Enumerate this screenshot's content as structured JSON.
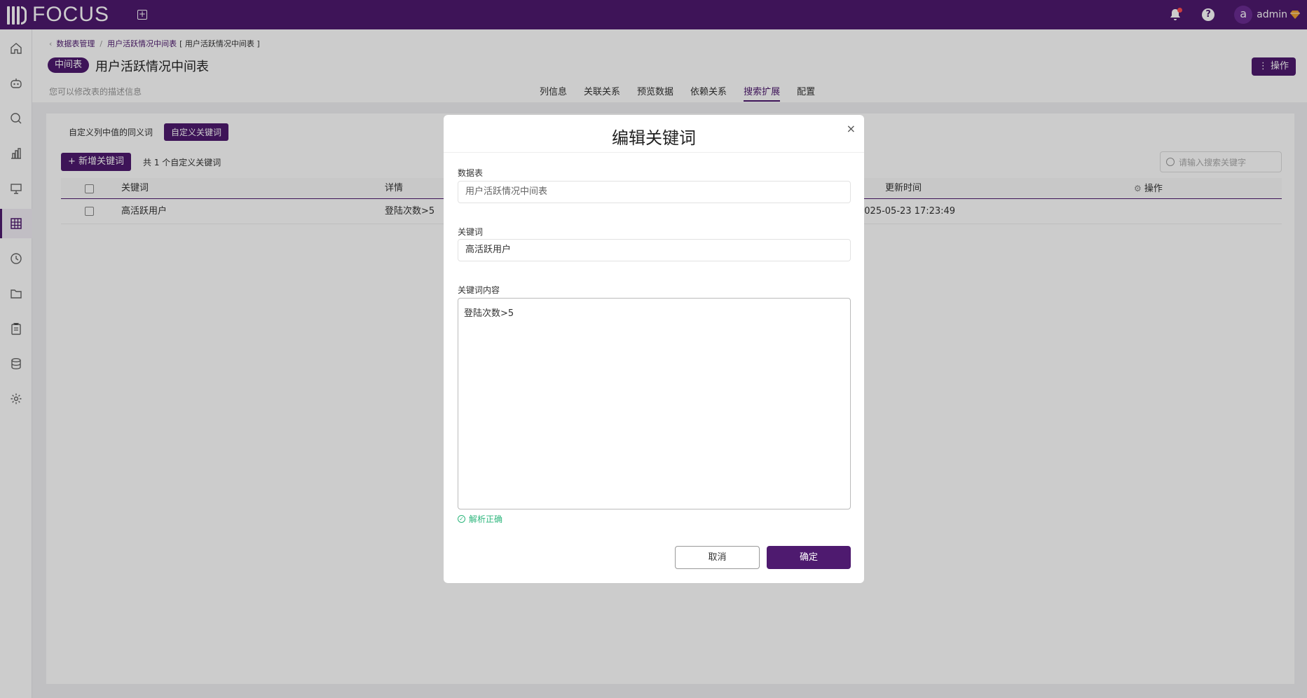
{
  "app": {
    "logo_text": "FOCUS",
    "user_initial": "a",
    "user_name": "admin"
  },
  "breadcrumb": {
    "root": "数据表管理",
    "parent": "用户活跃情况中间表",
    "current": "[ 用户活跃情况中间表 ]"
  },
  "header": {
    "tag": "中间表",
    "title": "用户活跃情况中间表",
    "description": "您可以修改表的描述信息",
    "ops_label": "⋮ 操作",
    "tabs": [
      {
        "label": "列信息",
        "active": false
      },
      {
        "label": "关联关系",
        "active": false
      },
      {
        "label": "预览数据",
        "active": false
      },
      {
        "label": "依赖关系",
        "active": false
      },
      {
        "label": "搜索扩展",
        "active": true
      },
      {
        "label": "配置",
        "active": false
      }
    ]
  },
  "content": {
    "sub_tabs": [
      "自定义列中值的同义词",
      "自定义关键词"
    ],
    "add_label": "+ 新增关键词",
    "count_text": "共 1 个自定义关键词",
    "search_placeholder": "请输入搜索关键字",
    "columns": {
      "keyword": "关键词",
      "detail": "详情",
      "updated": "更新时间",
      "ops": "操作"
    },
    "rows": [
      {
        "keyword": "高活跃用户",
        "detail": "登陆次数>5",
        "updated": "2025-05-23 17:23:49"
      }
    ]
  },
  "modal": {
    "title": "编辑关键词",
    "close": "×",
    "table_label": "数据表",
    "table_value": "用户活跃情况中间表",
    "keyword_label": "关键词",
    "keyword_value": "高活跃用户",
    "content_label": "关键词内容",
    "content_value": "登陆次数>5",
    "valid_text": "解析正确",
    "cancel_label": "取消",
    "confirm_label": "确定"
  },
  "colors": {
    "brand": "#4e1a6f",
    "success": "#2db67c"
  },
  "sidebar_icons": [
    "home-icon",
    "robot-icon",
    "search-icon",
    "chart-icon",
    "presentation-icon",
    "table-icon",
    "history-icon",
    "folder-icon",
    "clipboard-icon",
    "database-icon",
    "settings-icon"
  ]
}
